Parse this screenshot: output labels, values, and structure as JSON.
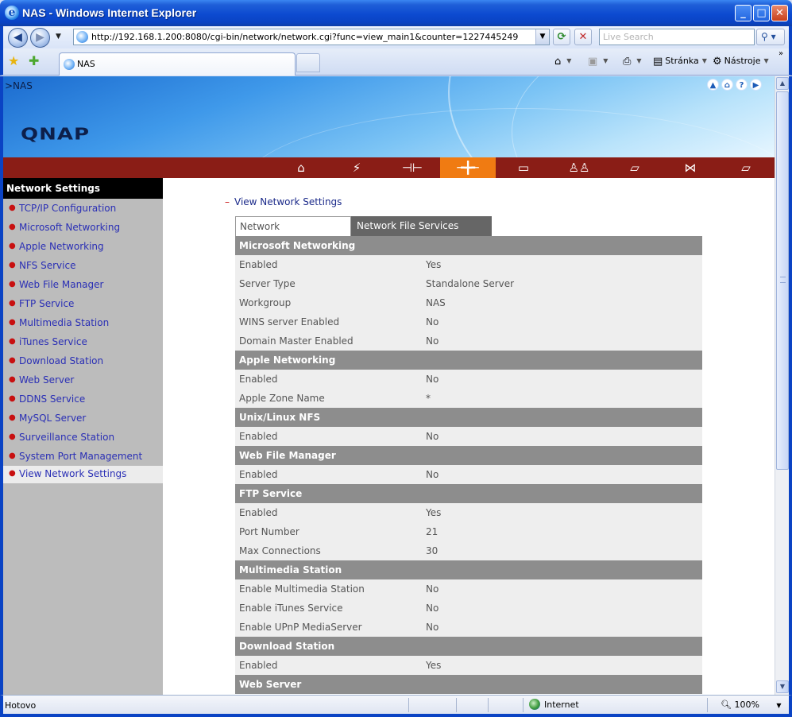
{
  "window": {
    "title": "NAS - Windows Internet Explorer",
    "icon_letter": "e",
    "minimize": "_",
    "maximize": "□",
    "close": "✕"
  },
  "address": {
    "url": "http://192.168.1.200:8080/cgi-bin/network/network.cgi?func=view_main1&counter=1227445249",
    "search_placeholder": "Live Search"
  },
  "tabs": {
    "active_label": "NAS"
  },
  "commands": {
    "page_label": "Stránka",
    "tools_label": "Nástroje"
  },
  "banner": {
    "breadcrumb": ">NAS",
    "logo": "QNAP"
  },
  "sidebar": {
    "title": "Network Settings",
    "items": [
      {
        "label": "TCP/IP Configuration"
      },
      {
        "label": "Microsoft Networking"
      },
      {
        "label": "Apple Networking"
      },
      {
        "label": "NFS Service"
      },
      {
        "label": "Web File Manager"
      },
      {
        "label": "FTP Service"
      },
      {
        "label": "Multimedia Station"
      },
      {
        "label": "iTunes Service"
      },
      {
        "label": "Download Station"
      },
      {
        "label": "Web Server"
      },
      {
        "label": "DDNS Service"
      },
      {
        "label": "MySQL Server"
      },
      {
        "label": "Surveillance Station"
      },
      {
        "label": "System Port Management"
      },
      {
        "label": "View Network Settings"
      }
    ],
    "active_index": 14
  },
  "main": {
    "section_title": "View Network Settings",
    "tab_network": "Network",
    "tab_nfs": "Network File Services",
    "groups": [
      {
        "title": "Microsoft Networking",
        "rows": [
          {
            "key": "Enabled",
            "value": "Yes"
          },
          {
            "key": "Server Type",
            "value": "Standalone Server"
          },
          {
            "key": "Workgroup",
            "value": "NAS"
          },
          {
            "key": "WINS server Enabled",
            "value": "No"
          },
          {
            "key": "Domain Master Enabled",
            "value": "No"
          }
        ]
      },
      {
        "title": "Apple Networking",
        "rows": [
          {
            "key": "Enabled",
            "value": "No"
          },
          {
            "key": "Apple Zone Name",
            "value": "*"
          }
        ]
      },
      {
        "title": "Unix/Linux NFS",
        "rows": [
          {
            "key": "Enabled",
            "value": "No"
          }
        ]
      },
      {
        "title": "Web File Manager",
        "rows": [
          {
            "key": "Enabled",
            "value": "No"
          }
        ]
      },
      {
        "title": "FTP Service",
        "rows": [
          {
            "key": "Enabled",
            "value": "Yes"
          },
          {
            "key": "Port Number",
            "value": "21"
          },
          {
            "key": "Max Connections",
            "value": "30"
          }
        ]
      },
      {
        "title": "Multimedia Station",
        "rows": [
          {
            "key": "Enable Multimedia Station",
            "value": "No"
          },
          {
            "key": "Enable iTunes Service",
            "value": "No"
          },
          {
            "key": "Enable UPnP MediaServer",
            "value": "No"
          }
        ]
      },
      {
        "title": "Download Station",
        "rows": [
          {
            "key": "Enabled",
            "value": "Yes"
          }
        ]
      },
      {
        "title": "Web Server",
        "rows": []
      }
    ]
  },
  "statusbar": {
    "status": "Hotovo",
    "zone": "Internet",
    "zoom": "100%"
  },
  "colors": {
    "menu_strip": "#8a1d16",
    "menu_active": "#f07b12",
    "sidebar_bg": "#bcbcbc",
    "group_header": "#8d8d8d",
    "row_bg": "#eeeeee",
    "link": "#2a2fb5"
  },
  "icons": {
    "nav_back": "back-arrow-icon",
    "nav_forward": "forward-arrow-icon",
    "refresh": "refresh-icon",
    "stop": "stop-icon",
    "search": "search-icon",
    "home": "home-icon",
    "feeds": "rss-icon",
    "print": "print-icon"
  }
}
